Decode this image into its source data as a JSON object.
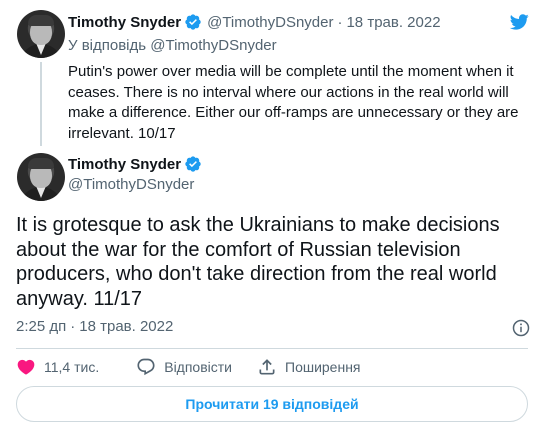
{
  "colors": {
    "accent": "#1d9bf0",
    "secondary_text": "#536471",
    "like_red": "#f91880",
    "divider": "#cfd9de"
  },
  "reply_tweet": {
    "author_name": "Timothy Snyder",
    "author_handle": "@TimothyDSnyder",
    "separator": "·",
    "date": "18 трав. 2022",
    "reply_prefix": "У відповідь",
    "reply_mention": "@TimothyDSnyder",
    "text": "Putin's power over media will be complete until the moment when it ceases. There is no interval where our actions in the real world will make a difference. Either our off-ramps are unnecessary or they are irrelevant. 10/17"
  },
  "main_tweet": {
    "author_name": "Timothy Snyder",
    "author_handle": "@TimothyDSnyder",
    "text": "It is grotesque to ask the Ukrainians to make decisions about the war for the comfort of Russian television producers, who don't take direction from the real world anyway. 11/17",
    "time": "2:25 дп",
    "separator": "·",
    "date": "18 трав. 2022"
  },
  "actions": {
    "likes_count": "11,4 тис.",
    "reply_label": "Відповісти",
    "share_label": "Поширення"
  },
  "read_replies_button": "Прочитати 19 відповідей",
  "icons": [
    "twitter-bird-icon",
    "verified-badge-icon",
    "info-icon",
    "heart-icon",
    "reply-bubble-icon",
    "share-icon"
  ]
}
